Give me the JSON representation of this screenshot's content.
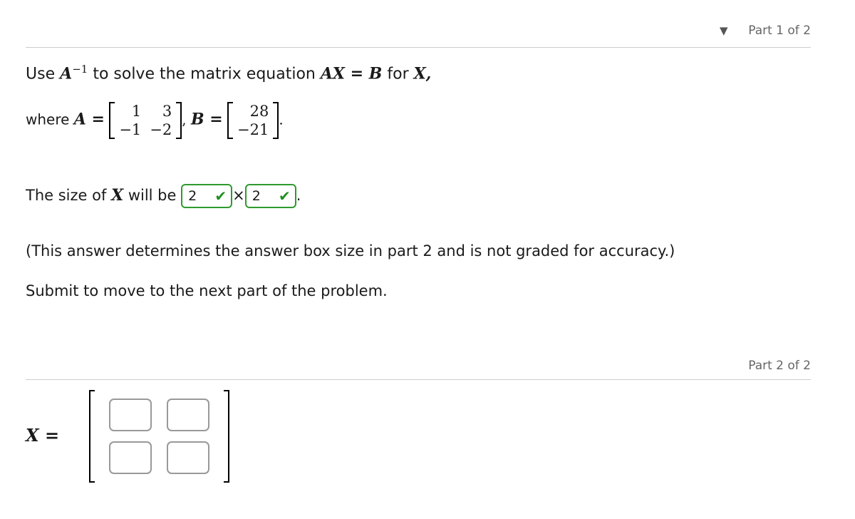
{
  "part1": {
    "label": "Part 1 of 2",
    "collapse_icon": "triangle-down-icon",
    "intro_prefix": "Use",
    "intro_matrix": "A",
    "intro_sup": "−1",
    "intro_mid": "to solve the matrix equation",
    "intro_eq": "AX = B",
    "intro_for": "for",
    "intro_var": "X,",
    "where_label": "where",
    "A_name": "A =",
    "A_matrix": [
      [
        "1",
        "3"
      ],
      [
        "−1",
        "−2"
      ]
    ],
    "B_name": "B =",
    "B_matrix": [
      [
        "28"
      ],
      [
        "−21"
      ]
    ],
    "size_prefix": "The size of",
    "size_var": "X",
    "size_mid": "will be",
    "rows_value": "2",
    "times": "×",
    "cols_value": "2",
    "period": ".",
    "note": "(This answer determines the answer box size in part 2 and is not graded for accuracy.)",
    "submit_note": "Submit to move to the next part of the problem.",
    "check_color": "#1f8f1f"
  },
  "part2": {
    "label": "Part 2 of 2",
    "lhs": "X =",
    "cells": [
      "",
      "",
      "",
      ""
    ]
  }
}
